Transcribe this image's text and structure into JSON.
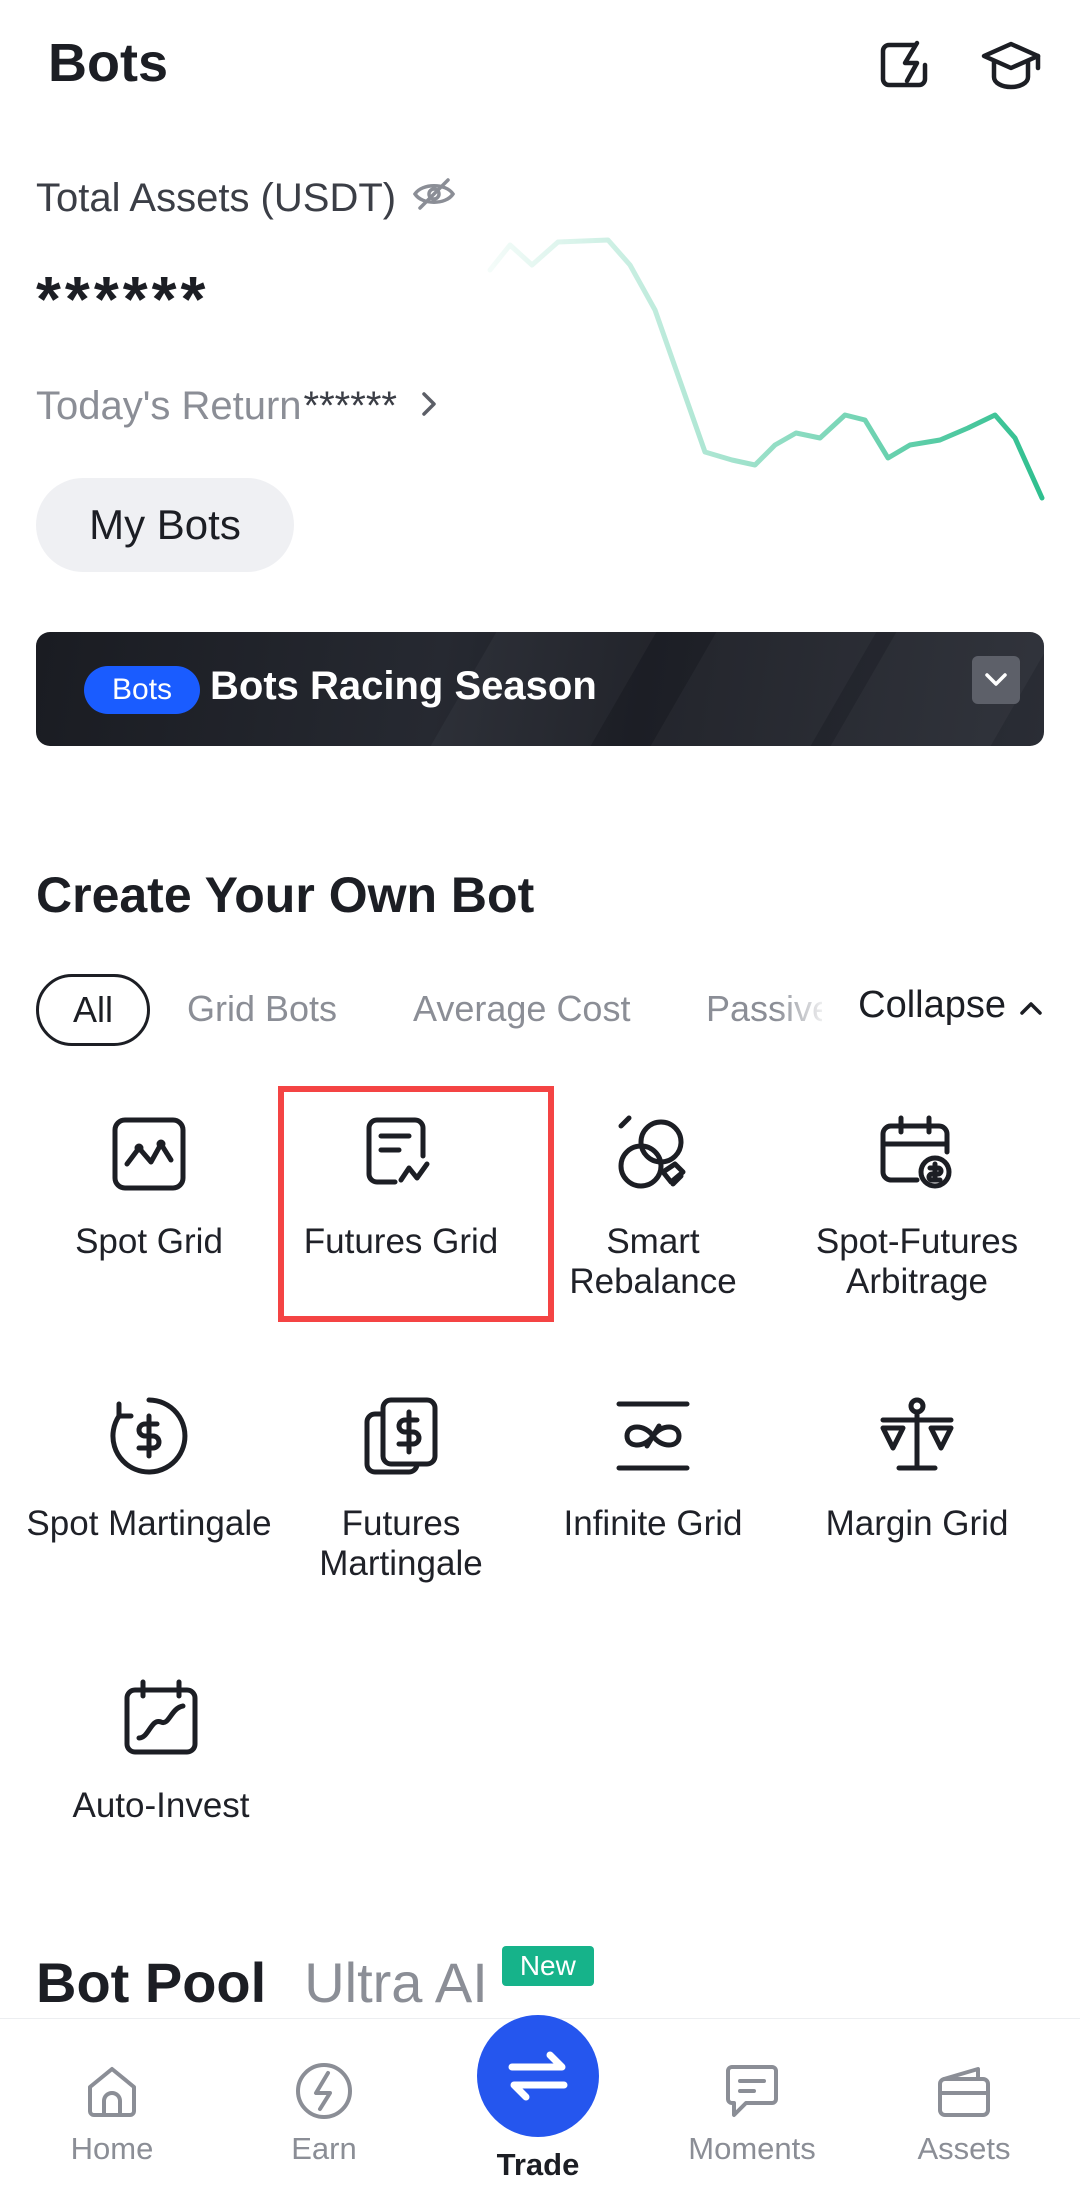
{
  "header": {
    "title": "Bots",
    "icons": [
      "share-icon",
      "learn-icon"
    ]
  },
  "assets": {
    "label": "Total Assets (USDT)",
    "value": "******",
    "return_label": "Today's Return",
    "return_value": "******",
    "hidden_icon": "eye-off-icon",
    "chart_color": "#2fbf8f"
  },
  "my_bots_label": "My Bots",
  "banner": {
    "badge": "Bots",
    "text": "Bots Racing Season",
    "badge_color": "#1a5cff"
  },
  "create_section": {
    "title": "Create Your Own Bot",
    "filters": [
      "All",
      "Grid Bots",
      "Average Cost",
      "Passive"
    ],
    "active_filter": "All",
    "collapse_label": "Collapse"
  },
  "bots": [
    {
      "label": "Spot Grid",
      "icon": "spot-grid-icon"
    },
    {
      "label": "Futures Grid",
      "icon": "futures-grid-icon"
    },
    {
      "label": "Smart Rebalance",
      "icon": "smart-rebalance-icon"
    },
    {
      "label": "Spot-Futures Arbitrage",
      "icon": "arbitrage-icon"
    },
    {
      "label": "Spot Martingale",
      "icon": "spot-martingale-icon"
    },
    {
      "label": "Futures Martingale",
      "icon": "futures-martingale-icon"
    },
    {
      "label": "Infinite Grid",
      "icon": "infinite-grid-icon"
    },
    {
      "label": "Margin Grid",
      "icon": "margin-grid-icon"
    },
    {
      "label": "Auto-Invest",
      "icon": "auto-invest-icon"
    }
  ],
  "highlighted_bot": "Futures Grid",
  "highlight_color": "#f44444",
  "pool": {
    "title": "Bot Pool",
    "tab": "Ultra AI",
    "badge": "New",
    "badge_color": "#16b38a"
  },
  "nav": {
    "items": [
      "Home",
      "Earn",
      "Trade",
      "Moments",
      "Assets"
    ],
    "active": "Trade",
    "accent": "#2556ee"
  }
}
